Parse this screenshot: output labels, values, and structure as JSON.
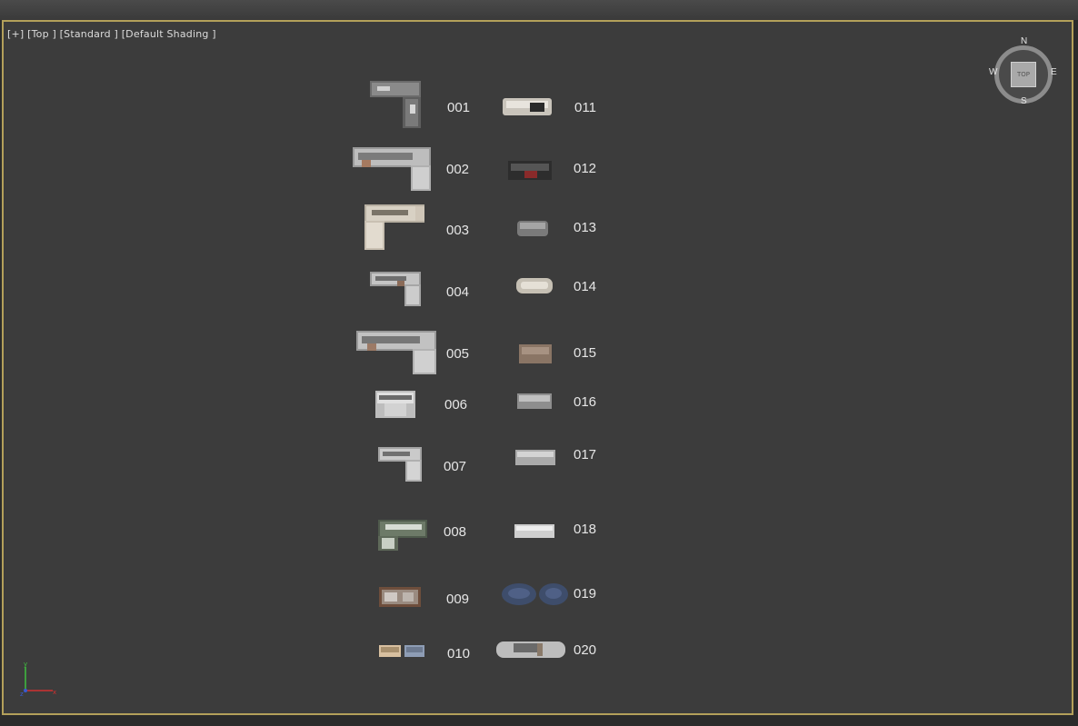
{
  "viewport": {
    "label_plus": "[+]",
    "label_view": "[Top ]",
    "label_mode": "[Standard ]",
    "label_shading": "[Default Shading ]"
  },
  "viewcube": {
    "n": "N",
    "s": "S",
    "e": "E",
    "w": "W",
    "face": "TOP"
  },
  "axis": {
    "y": "y",
    "x": "x",
    "z": "z"
  },
  "items": [
    {
      "id": "001"
    },
    {
      "id": "002"
    },
    {
      "id": "003"
    },
    {
      "id": "004"
    },
    {
      "id": "005"
    },
    {
      "id": "006"
    },
    {
      "id": "007"
    },
    {
      "id": "008"
    },
    {
      "id": "009"
    },
    {
      "id": "010"
    },
    {
      "id": "011"
    },
    {
      "id": "012"
    },
    {
      "id": "013"
    },
    {
      "id": "014"
    },
    {
      "id": "015"
    },
    {
      "id": "016"
    },
    {
      "id": "017"
    },
    {
      "id": "018"
    },
    {
      "id": "019"
    },
    {
      "id": "020"
    }
  ],
  "colors": {
    "viewport_border": "#b3a05a",
    "viewport_bg": "#3c3c3c",
    "label": "#e6e6e6"
  }
}
